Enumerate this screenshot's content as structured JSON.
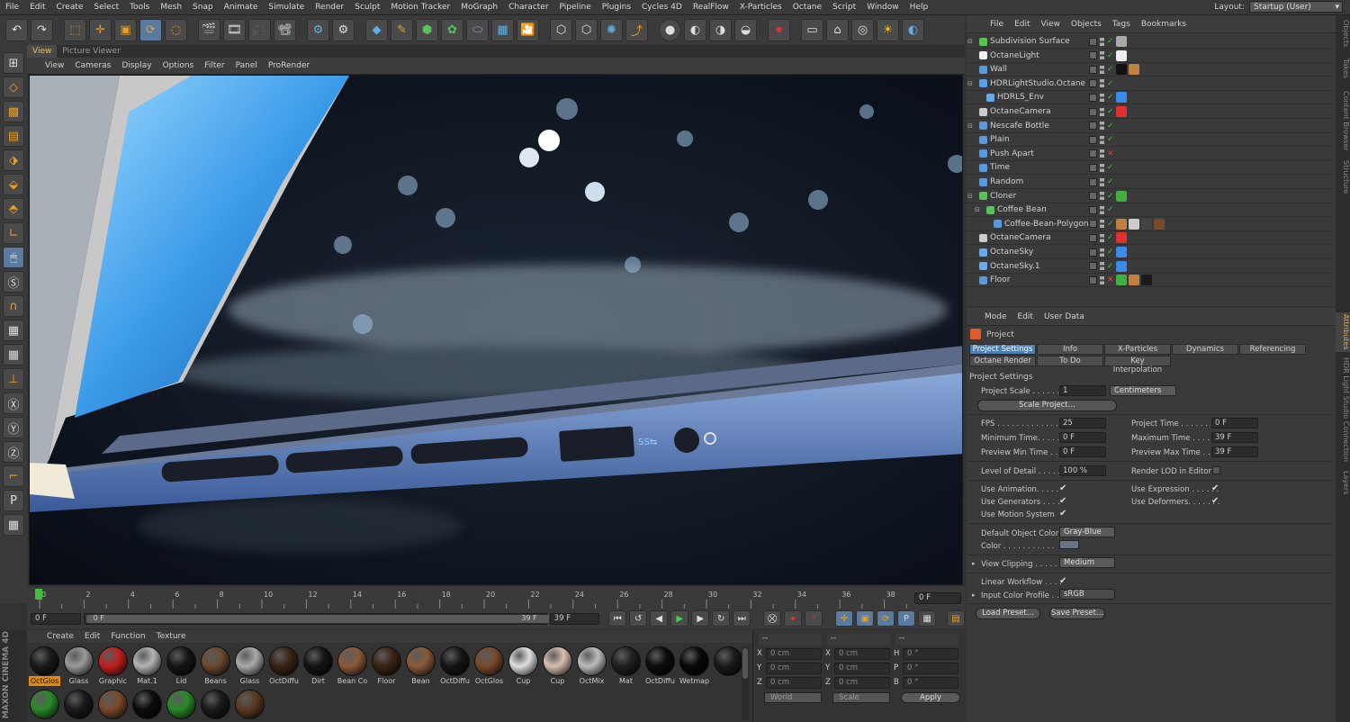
{
  "menu": [
    "File",
    "Edit",
    "Create",
    "Select",
    "Tools",
    "Mesh",
    "Snap",
    "Animate",
    "Simulate",
    "Render",
    "Sculpt",
    "Motion Tracker",
    "MoGraph",
    "Character",
    "Pipeline",
    "Plugins",
    "Cycles 4D",
    "RealFlow",
    "X-Particles",
    "Octane",
    "Script",
    "Window",
    "Help"
  ],
  "layout": {
    "label": "Layout:",
    "value": "Startup (User)"
  },
  "view_tabs": [
    "View",
    "Picture Viewer"
  ],
  "view_menu": [
    "View",
    "Cameras",
    "Display",
    "Options",
    "Filter",
    "Panel",
    "ProRender"
  ],
  "timeline": {
    "ticks": [
      "0",
      "2",
      "4",
      "6",
      "8",
      "10",
      "12",
      "14",
      "16",
      "18",
      "20",
      "22",
      "24",
      "26",
      "28",
      "30",
      "32",
      "34",
      "36",
      "38"
    ],
    "frame": "0 F",
    "start": "0 F",
    "range_start": "0 F",
    "range_end": "39 F",
    "end": "39 F"
  },
  "materials": {
    "menu": [
      "Create",
      "Edit",
      "Function",
      "Texture"
    ],
    "items": [
      {
        "name": "OctGlos",
        "color": "#1a1a1a",
        "selected": true
      },
      {
        "name": "Glass",
        "color": "#9a9a9a"
      },
      {
        "name": "Graphic",
        "color": "#c02020"
      },
      {
        "name": "Mat.1",
        "color": "#b5b5b5"
      },
      {
        "name": "Lid",
        "color": "#151515"
      },
      {
        "name": "Beans",
        "color": "#6a4a30"
      },
      {
        "name": "Glass",
        "color": "#aaaaaa"
      },
      {
        "name": "OctDiffu",
        "color": "#3a2416"
      },
      {
        "name": "Dirt",
        "color": "#141414"
      },
      {
        "name": "Bean Co",
        "color": "#8a5a3a"
      },
      {
        "name": "Floor",
        "color": "#3a2416"
      },
      {
        "name": "Bean",
        "color": "#8a5a3a"
      },
      {
        "name": "OctDiffu",
        "color": "#161616"
      },
      {
        "name": "OctGlos",
        "color": "#7a4a2c"
      },
      {
        "name": "Cup",
        "color": "#e0e0e0"
      },
      {
        "name": "Cup",
        "color": "#d8c0b0"
      },
      {
        "name": "OctMix",
        "color": "#bdbdbd"
      },
      {
        "name": "Mat",
        "color": "#202020"
      },
      {
        "name": "OctDiffu",
        "color": "#0c0c0c"
      },
      {
        "name": "Wetmap",
        "color": "#080808"
      }
    ],
    "row2": [
      {
        "name": "",
        "color": "#1a1a1a"
      },
      {
        "name": "",
        "color": "#2a8a2a"
      },
      {
        "name": "",
        "color": "#1a1a1a"
      },
      {
        "name": "",
        "color": "#7a4a2c"
      },
      {
        "name": "",
        "color": "#0c0c0c"
      },
      {
        "name": "",
        "color": "#2a8a2a"
      },
      {
        "name": "",
        "color": "#1a1a1a"
      },
      {
        "name": "",
        "color": "#5a3a22"
      }
    ]
  },
  "coord": {
    "headers": [
      "--",
      "--",
      "--"
    ],
    "rows": [
      {
        "a": "X",
        "av": "0 cm",
        "b": "X",
        "bv": "0 cm",
        "c": "H",
        "cv": "0 °"
      },
      {
        "a": "Y",
        "av": "0 cm",
        "b": "Y",
        "bv": "0 cm",
        "c": "P",
        "cv": "0 °"
      },
      {
        "a": "Z",
        "av": "0 cm",
        "b": "Z",
        "bv": "0 cm",
        "c": "B",
        "cv": "0 °"
      }
    ],
    "world": "World",
    "scale": "Scale",
    "apply": "Apply"
  },
  "brand": {
    "maxon": "MAXON",
    "product": "CINEMA 4D"
  },
  "objects": {
    "menu": [
      "File",
      "Edit",
      "View",
      "Objects",
      "Tags",
      "Bookmarks"
    ],
    "rows": [
      {
        "name": "Subdivision Surface",
        "indent": 0,
        "icon": "#5ac05a"
      },
      {
        "name": "OctaneLight",
        "indent": 0,
        "icon": "#f0f0f0"
      },
      {
        "name": "Wall",
        "indent": 0,
        "icon": "#5a9ad8"
      },
      {
        "name": "HDRLightStudio.Octane",
        "indent": 0,
        "icon": "#5aa0e0"
      },
      {
        "name": "HDRLS_Env",
        "indent": 1,
        "icon": "#6aa8e8"
      },
      {
        "name": "OctaneCamera",
        "indent": 0,
        "icon": "#cccccc"
      },
      {
        "name": "Nescafe Bottle",
        "indent": 0,
        "icon": "#5a9ad8"
      },
      {
        "name": "Plain",
        "indent": 0,
        "icon": "#5a9ad8"
      },
      {
        "name": "Push Apart",
        "indent": 0,
        "icon": "#5a9ad8"
      },
      {
        "name": "Time",
        "indent": 0,
        "icon": "#5a9ad8"
      },
      {
        "name": "Random",
        "indent": 0,
        "icon": "#5a9ad8"
      },
      {
        "name": "Cloner",
        "indent": 0,
        "icon": "#5ac05a"
      },
      {
        "name": "Coffee Bean",
        "indent": 1,
        "icon": "#5ac05a"
      },
      {
        "name": "Coffee-Bean-Polygon",
        "indent": 2,
        "icon": "#5a9ad8"
      },
      {
        "name": "OctaneCamera",
        "indent": 0,
        "icon": "#cccccc"
      },
      {
        "name": "OctaneSky",
        "indent": 0,
        "icon": "#6aa8e8"
      },
      {
        "name": "OctaneSky.1",
        "indent": 0,
        "icon": "#6aa8e8"
      },
      {
        "name": "Floor",
        "indent": 0,
        "icon": "#5a9ad8"
      }
    ]
  },
  "attributes": {
    "menu": [
      "Mode",
      "Edit",
      "User Data"
    ],
    "title": "Project",
    "tabs_row1": [
      "Project Settings",
      "Info",
      "X-Particles",
      "Dynamics",
      "Referencing"
    ],
    "tabs_row2": [
      "Octane Render",
      "To Do",
      "Key Interpolation"
    ],
    "section": "Project Settings",
    "project_scale_label": "Project Scale . . . . . .",
    "project_scale_value": "1",
    "project_scale_unit": "Centimeters",
    "scale_project_button": "Scale Project...",
    "fps_label": "FPS . . . . . . . . . . . . . .",
    "fps_value": "25",
    "project_time_label": "Project Time . . . . . . . .",
    "project_time_value": "0 F",
    "min_time_label": "Minimum Time. . . . . . . .",
    "min_time_value": "0 F",
    "max_time_label": "Maximum Time . . . . . . .",
    "max_time_value": "39 F",
    "prev_min_label": "Preview Min Time . . . .",
    "prev_min_value": "0 F",
    "prev_max_label": "Preview Max Time . . . .",
    "prev_max_value": "39 F",
    "lod_label": "Level of Detail . . . . .",
    "lod_value": "100 %",
    "render_lod_label": "Render LOD in Editor",
    "use_anim_label": "Use Animation. . . . .",
    "use_expr_label": "Use Expression . . . . . .",
    "use_gen_label": "Use Generators . . . .",
    "use_def_label": "Use Deformers. . . . . . .",
    "use_motion_label": "Use Motion System",
    "default_color_label": "Default Object Color",
    "default_color_value": "Gray-Blue",
    "color_label": "Color . . . . . . . . . . .",
    "view_clip_label": "View Clipping . . . . .",
    "view_clip_value": "Medium",
    "linear_label": "Linear Workflow . . . .",
    "input_profile_label": "Input Color Profile . .",
    "input_profile_value": "sRGB",
    "load_preset": "Load Preset...",
    "save_preset": "Save Preset..."
  },
  "right_tabs": [
    "Objects",
    "Takes",
    "Content Browser",
    "Structure",
    "Attributes",
    "HDR Light Studio Connection",
    "Layers"
  ]
}
